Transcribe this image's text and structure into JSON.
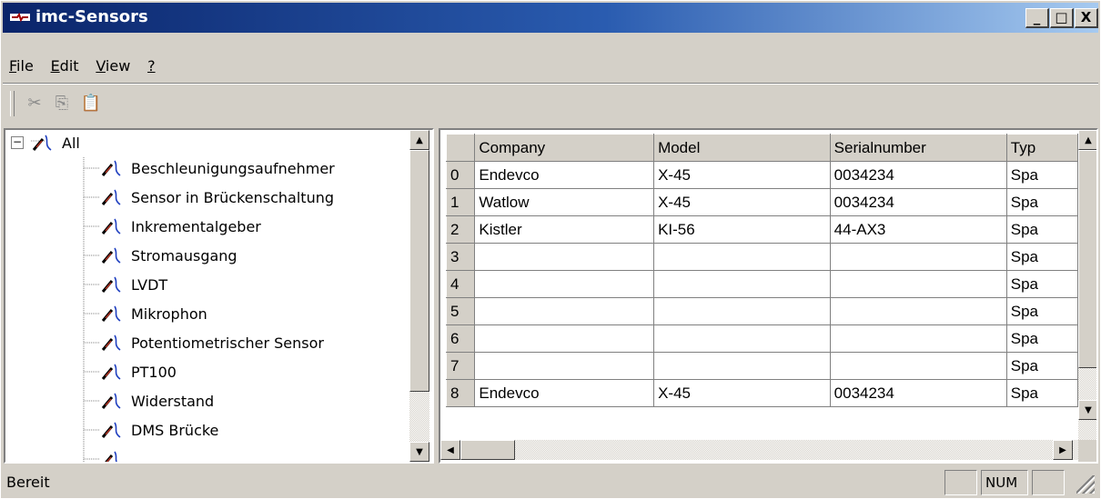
{
  "window": {
    "title": "imc-Sensors",
    "controls": {
      "minimize": "_",
      "maximize": "□",
      "close": "X"
    }
  },
  "menu": [
    {
      "label": "File",
      "accel": "F",
      "rest": "ile"
    },
    {
      "label": "Edit",
      "accel": "E",
      "rest": "dit"
    },
    {
      "label": "View",
      "accel": "V",
      "rest": "iew"
    },
    {
      "label": "?",
      "accel": "?",
      "rest": ""
    }
  ],
  "toolbar": {
    "buttons": [
      {
        "name": "cut-icon",
        "glyph": "✂"
      },
      {
        "name": "copy-icon",
        "glyph": "⎘"
      },
      {
        "name": "paste-icon",
        "glyph": "📋"
      }
    ]
  },
  "tree": {
    "root": {
      "label": "All",
      "expander": "−"
    },
    "items": [
      "Beschleunigungsaufnehmer",
      "Sensor in Brückenschaltung",
      "Inkrementalgeber",
      "Stromausgang",
      "LVDT",
      "Mikrophon",
      "Potentiometrischer Sensor",
      "PT100",
      "Widerstand",
      "DMS Brücke"
    ]
  },
  "grid": {
    "columns": [
      "Company",
      "Model",
      "Serialnumber",
      "Typ"
    ],
    "rows": [
      {
        "index": "0",
        "company": "Endevco",
        "model": "X-45",
        "serial": "0034234",
        "type": "Spa"
      },
      {
        "index": "1",
        "company": "Watlow",
        "model": "X-45",
        "serial": "0034234",
        "type": "Spa"
      },
      {
        "index": "2",
        "company": "Kistler",
        "model": "KI-56",
        "serial": "44-AX3",
        "type": "Spa"
      },
      {
        "index": "3",
        "company": "",
        "model": "",
        "serial": "",
        "type": "Spa"
      },
      {
        "index": "4",
        "company": "",
        "model": "",
        "serial": "",
        "type": "Spa"
      },
      {
        "index": "5",
        "company": "",
        "model": "",
        "serial": "",
        "type": "Spa"
      },
      {
        "index": "6",
        "company": "",
        "model": "",
        "serial": "",
        "type": "Spa"
      },
      {
        "index": "7",
        "company": "",
        "model": "",
        "serial": "",
        "type": "Spa"
      },
      {
        "index": "8",
        "company": "Endevco",
        "model": "X-45",
        "serial": "0034234",
        "type": "Spa"
      }
    ]
  },
  "status": {
    "text": "Bereit",
    "panels": [
      "",
      "NUM",
      ""
    ]
  },
  "colors": {
    "titlebar_start": "#0a246a",
    "titlebar_end": "#a6caf0",
    "face": "#d4d0c8"
  }
}
